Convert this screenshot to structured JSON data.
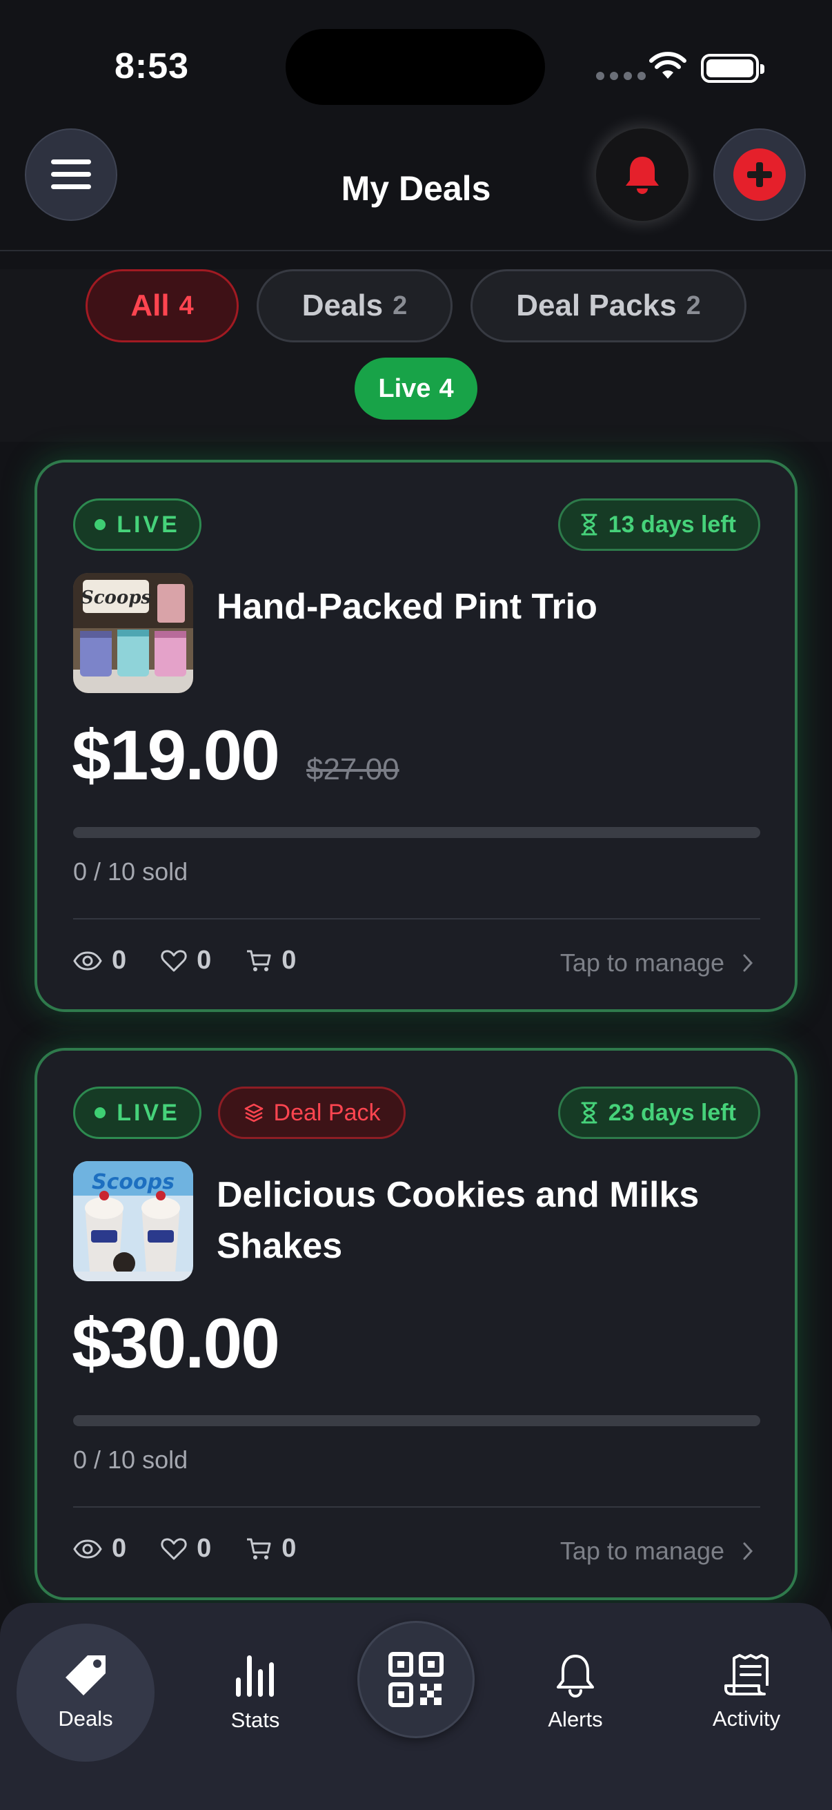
{
  "status_bar": {
    "time": "8:53"
  },
  "header": {
    "title": "My Deals"
  },
  "filters": {
    "all": {
      "label": "All",
      "count": "4"
    },
    "deals": {
      "label": "Deals",
      "count": "2"
    },
    "packs": {
      "label": "Deal Packs",
      "count": "2"
    },
    "live": {
      "label": "Live",
      "count": "4"
    }
  },
  "deals": [
    {
      "status": "LIVE",
      "time_left": "13 days left",
      "title": "Hand-Packed Pint Trio",
      "price": "$19.00",
      "original_price": "$27.00",
      "sold_text": "0 / 10 sold",
      "sold_fraction": 0,
      "views": "0",
      "likes": "0",
      "carts": "0",
      "manage_label": "Tap to manage",
      "thumb_brand": "Scoops"
    },
    {
      "status": "LIVE",
      "pack_label": "Deal Pack",
      "time_left": "23 days left",
      "title": "Delicious Cookies and Milks Shakes",
      "price": "$30.00",
      "sold_text": "0 / 10 sold",
      "sold_fraction": 0,
      "views": "0",
      "likes": "0",
      "carts": "0",
      "manage_label": "Tap to manage",
      "thumb_brand": "Scoops"
    }
  ],
  "tabbar": {
    "deals": "Deals",
    "stats": "Stats",
    "alerts": "Alerts",
    "activity": "Activity"
  },
  "colors": {
    "accent_red": "#e5202b",
    "live_green": "#18a348",
    "background": "#121317",
    "card": "#1c1e25"
  }
}
